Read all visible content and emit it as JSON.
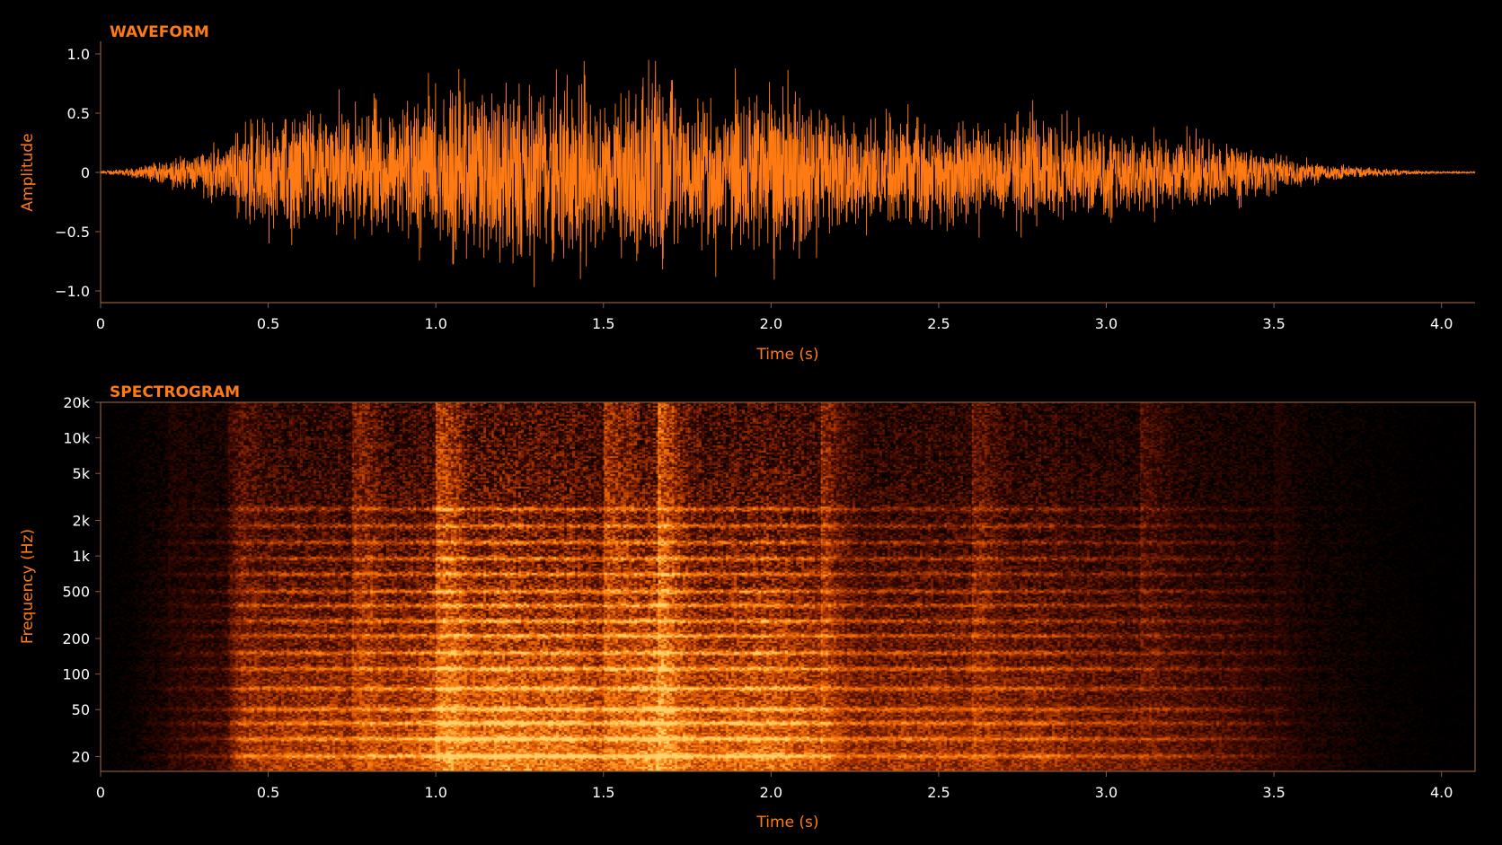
{
  "colors": {
    "background": "#000000",
    "accent": "#ff7a12",
    "tick_text": "#ffffff",
    "axis": "#8a5a3a"
  },
  "chart_data": [
    {
      "type": "line",
      "title": "WAVEFORM",
      "xlabel": "Time (s)",
      "ylabel": "Amplitude",
      "xlim": [
        0,
        4.1
      ],
      "ylim": [
        -1.1,
        1.1
      ],
      "x_ticks": [
        0,
        0.5,
        1.0,
        1.5,
        2.0,
        2.5,
        3.0,
        3.5,
        4.0
      ],
      "x_tick_labels": [
        "0",
        "0.5",
        "1.0",
        "1.5",
        "2.0",
        "2.5",
        "3.0",
        "3.5",
        "4.0"
      ],
      "y_ticks": [
        1.0,
        0.5,
        0,
        -0.5,
        -1.0
      ],
      "y_tick_labels": [
        "1.0",
        "0.5",
        "0",
        "−0.5",
        "−1.0"
      ],
      "envelope": {
        "x": [
          0,
          0.1,
          0.2,
          0.3,
          0.38,
          0.42,
          0.5,
          0.6,
          0.7,
          0.75,
          0.8,
          0.9,
          1.0,
          1.05,
          1.1,
          1.2,
          1.3,
          1.4,
          1.5,
          1.6,
          1.66,
          1.72,
          1.8,
          1.9,
          2.0,
          2.08,
          2.15,
          2.2,
          2.3,
          2.4,
          2.5,
          2.6,
          2.7,
          2.8,
          2.9,
          3.0,
          3.1,
          3.2,
          3.3,
          3.4,
          3.5,
          3.6,
          3.7,
          3.8,
          3.9,
          4.0,
          4.1
        ],
        "amplitude": [
          0.02,
          0.05,
          0.15,
          0.25,
          0.3,
          0.55,
          0.62,
          0.68,
          0.7,
          0.6,
          0.72,
          0.75,
          0.85,
          1.0,
          0.9,
          1.05,
          0.95,
          0.98,
          0.8,
          0.95,
          1.1,
          0.9,
          0.85,
          0.9,
          0.95,
          0.85,
          0.75,
          0.6,
          0.58,
          0.62,
          0.6,
          0.58,
          0.55,
          0.6,
          0.5,
          0.48,
          0.42,
          0.4,
          0.35,
          0.3,
          0.2,
          0.12,
          0.08,
          0.05,
          0.03,
          0.01,
          0.01
        ]
      }
    },
    {
      "type": "heatmap",
      "title": "SPECTROGRAM",
      "xlabel": "Time (s)",
      "ylabel": "Frequency (Hz)",
      "xlim": [
        0,
        4.1
      ],
      "ylim": [
        15,
        20000
      ],
      "y_scale": "log",
      "x_ticks": [
        0,
        0.5,
        1.0,
        1.5,
        2.0,
        2.5,
        3.0,
        3.5,
        4.0
      ],
      "x_tick_labels": [
        "0",
        "0.5",
        "1.0",
        "1.5",
        "2.0",
        "2.5",
        "3.0",
        "3.5",
        "4.0"
      ],
      "y_ticks": [
        20000,
        10000,
        5000,
        2000,
        1000,
        500,
        200,
        100,
        50,
        20
      ],
      "y_tick_labels": [
        "20k",
        "10k",
        "5k",
        "2k",
        "1k",
        "500",
        "200",
        "100",
        "50",
        "20"
      ],
      "colormap": [
        "#000000",
        "#3a0800",
        "#8a2600",
        "#e05a00",
        "#ff8c1a",
        "#ffd36a"
      ],
      "harmonic_bands_hz": [
        20,
        28,
        38,
        50,
        75,
        110,
        150,
        210,
        280,
        380,
        500,
        700,
        950,
        1300,
        1800,
        2500
      ],
      "onsets_s": [
        0.2,
        0.38,
        0.75,
        1.0,
        1.5,
        1.66,
        2.15,
        2.6,
        3.1,
        3.5
      ]
    }
  ]
}
